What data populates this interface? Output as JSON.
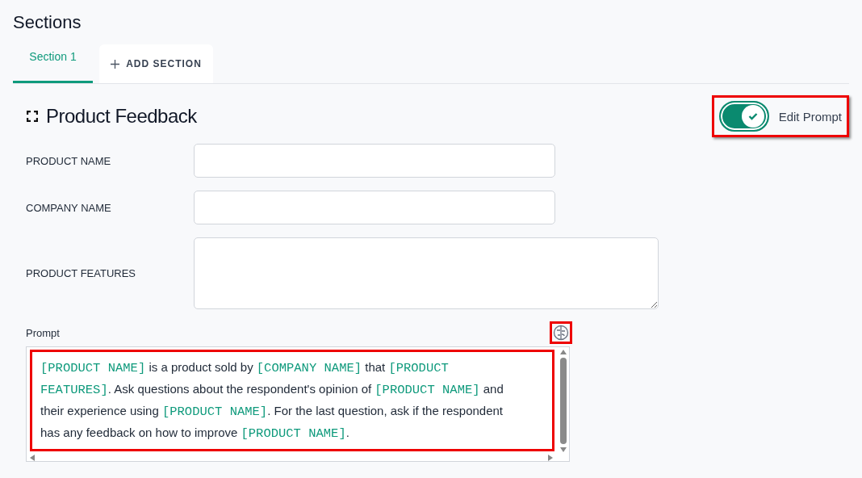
{
  "page_title": "Sections",
  "tabs": [
    {
      "label": "Section 1",
      "selected": true,
      "kind": "tab"
    },
    {
      "label": "ADD SECTION",
      "selected": false,
      "kind": "add"
    }
  ],
  "section": {
    "title": "Product Feedback",
    "edit_toggle": {
      "label": "Edit Prompt",
      "on": true,
      "highlighted": true
    }
  },
  "fields": [
    {
      "label": "PRODUCT NAME",
      "kind": "input"
    },
    {
      "label": "COMPANY NAME",
      "kind": "input"
    },
    {
      "label": "PRODUCT FEATURES",
      "kind": "textarea"
    }
  ],
  "prompt": {
    "label": "Prompt",
    "icon_highlighted": true,
    "text_highlighted": true,
    "segments": [
      {
        "kind": "variable",
        "text": "[PRODUCT NAME]"
      },
      {
        "kind": "text",
        "text": " is a product sold by "
      },
      {
        "kind": "variable",
        "text": "[COMPANY NAME]"
      },
      {
        "kind": "text",
        "text": " that "
      },
      {
        "kind": "variable",
        "text": "[PRODUCT FEATURES]"
      },
      {
        "kind": "text",
        "text": ". Ask questions about the respondent's opinion of "
      },
      {
        "kind": "variable",
        "text": "[PRODUCT NAME]"
      },
      {
        "kind": "text",
        "text": " and their experience using "
      },
      {
        "kind": "variable",
        "text": "[PRODUCT NAME]"
      },
      {
        "kind": "text",
        "text": ". For the last question, ask if the respondent has any feedback on how to improve "
      },
      {
        "kind": "variable",
        "text": "[PRODUCT NAME]"
      },
      {
        "kind": "text",
        "text": "."
      }
    ]
  }
}
